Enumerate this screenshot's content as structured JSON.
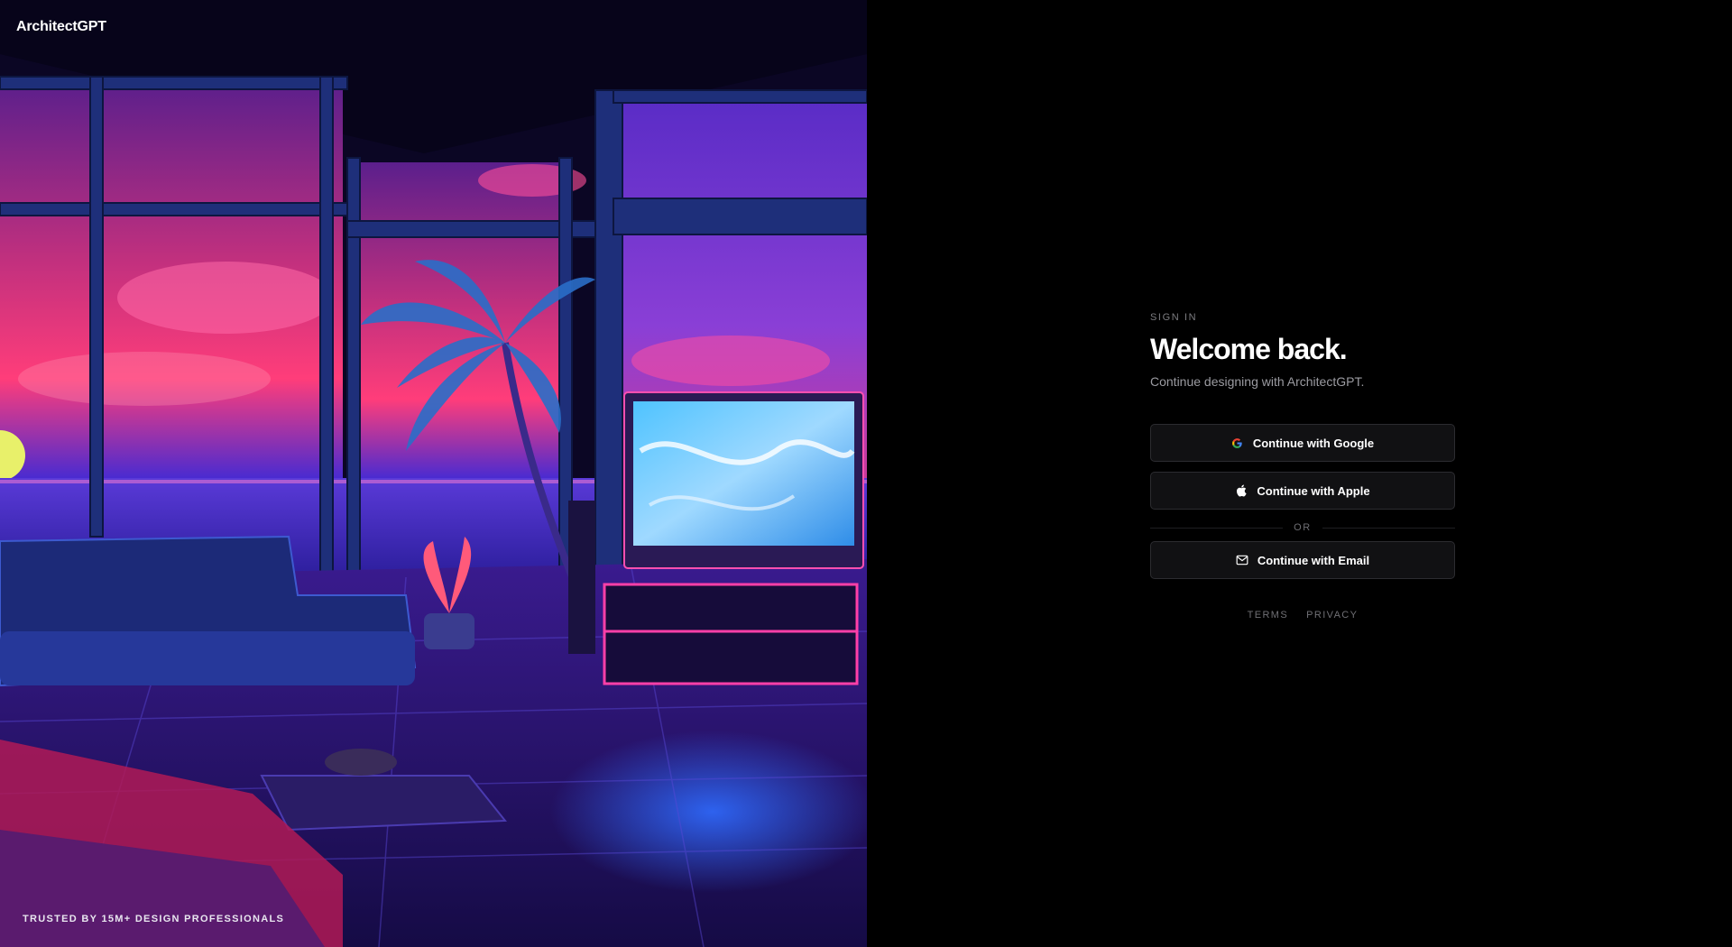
{
  "brand": {
    "name": "ArchitectGPT"
  },
  "hero": {
    "tagline": "TRUSTED BY 15M+ DESIGN PROFESSIONALS",
    "image_description_icon": "neon-living-room-illustration"
  },
  "auth": {
    "eyebrow": "SIGN IN",
    "title": "Welcome back.",
    "subtitle": "Continue designing with ArchitectGPT.",
    "buttons": {
      "google": "Continue with Google",
      "apple": "Continue with Apple",
      "email": "Continue with Email"
    },
    "divider": "OR",
    "links": {
      "terms": "TERMS",
      "privacy": "PRIVACY"
    }
  },
  "icons": {
    "google": "google-icon",
    "apple": "apple-icon",
    "email": "mail-icon"
  },
  "colors": {
    "background": "#000000",
    "button_bg": "#111113",
    "button_border": "#2c2c30",
    "text_primary": "#ffffff",
    "text_muted": "#9b9ba1"
  }
}
